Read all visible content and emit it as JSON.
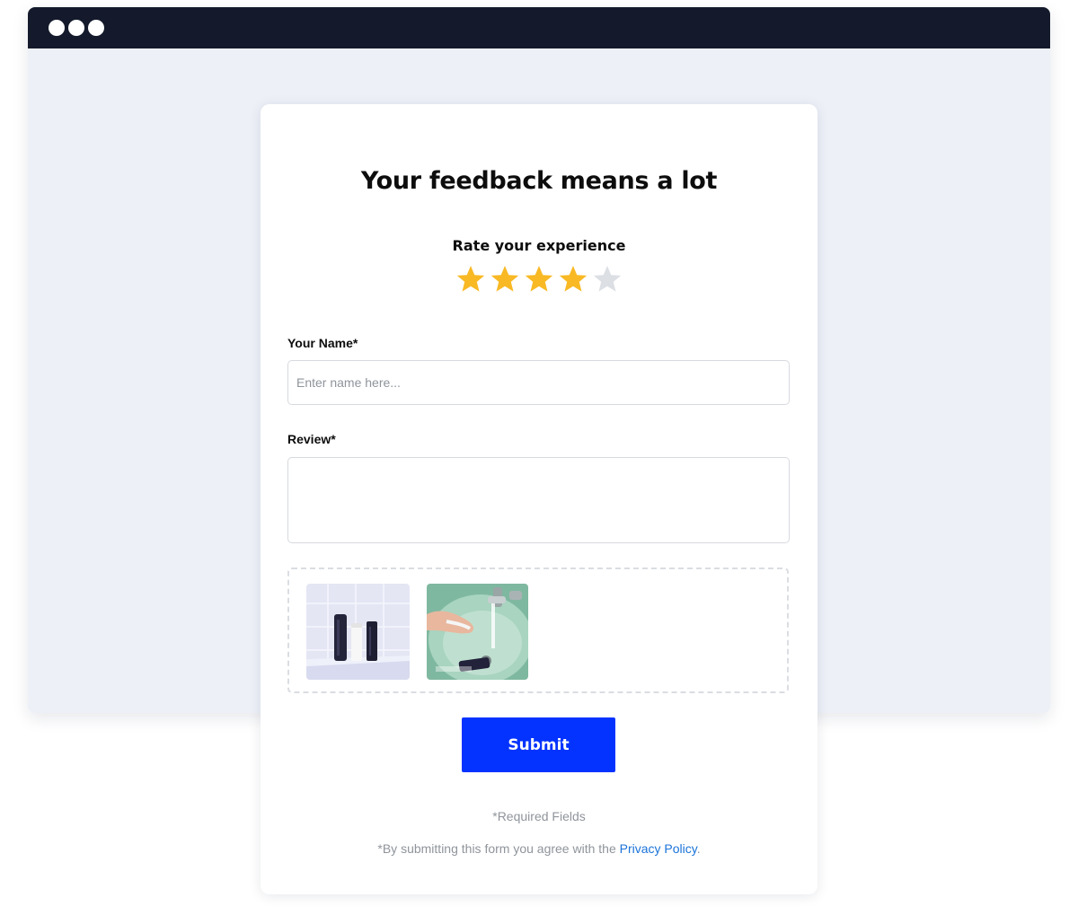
{
  "form": {
    "title": "Your feedback means a lot",
    "rating_label": "Rate your experience",
    "rating": {
      "value": 4,
      "max": 5,
      "filled_color": "#f8b925",
      "empty_color": "#dcdfe4"
    },
    "name_label": "Your Name*",
    "name_placeholder": "Enter name here...",
    "name_value": "",
    "review_label": "Review*",
    "review_value": "",
    "uploads": [
      {
        "name": "product-bottles-photo"
      },
      {
        "name": "hand-washing-sink-photo"
      }
    ],
    "submit_label": "Submit",
    "required_note": "*Required Fields",
    "agree_prefix": "*By submitting this form you agree with the",
    "privacy_link": "Privacy Policy",
    "agree_suffix": "."
  },
  "colors": {
    "titlebar": "#141a2b",
    "page_background": "#edf0f7",
    "submit": "#0433ff",
    "link": "#1a73d9"
  }
}
